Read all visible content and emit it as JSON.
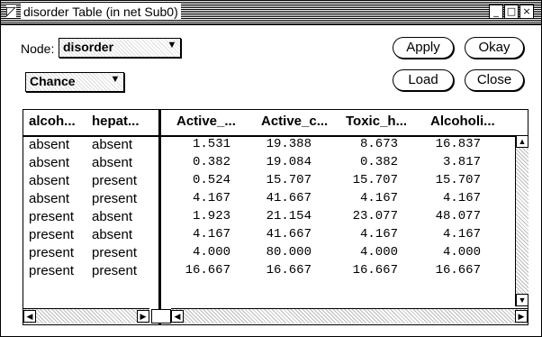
{
  "window": {
    "title": "disorder Table (in net Sub0)",
    "title_icon": "app-icon",
    "controls": [
      "_",
      "□",
      "×"
    ]
  },
  "node_label": "Node:",
  "node_select": "disorder",
  "type_select": "Chance",
  "buttons": {
    "apply": "Apply",
    "okay": "Okay",
    "load": "Load",
    "close": "Close"
  },
  "table": {
    "headers": [
      "alcoh...",
      "hepat...",
      "Active_...",
      "Active_c...",
      "Toxic_h...",
      "Alcoholi..."
    ],
    "rows": [
      [
        "absent",
        "absent",
        "1.531",
        "19.388",
        "8.673",
        "16.837"
      ],
      [
        "absent",
        "absent",
        "0.382",
        "19.084",
        "0.382",
        "3.817"
      ],
      [
        "absent",
        "present",
        "0.524",
        "15.707",
        "15.707",
        "15.707"
      ],
      [
        "absent",
        "present",
        "4.167",
        "41.667",
        "4.167",
        "4.167"
      ],
      [
        "present",
        "absent",
        "1.923",
        "21.154",
        "23.077",
        "48.077"
      ],
      [
        "present",
        "absent",
        "4.167",
        "41.667",
        "4.167",
        "4.167"
      ],
      [
        "present",
        "present",
        "4.000",
        "80.000",
        "4.000",
        "4.000"
      ],
      [
        "present",
        "present",
        "16.667",
        "16.667",
        "16.667",
        "16.667"
      ]
    ]
  }
}
